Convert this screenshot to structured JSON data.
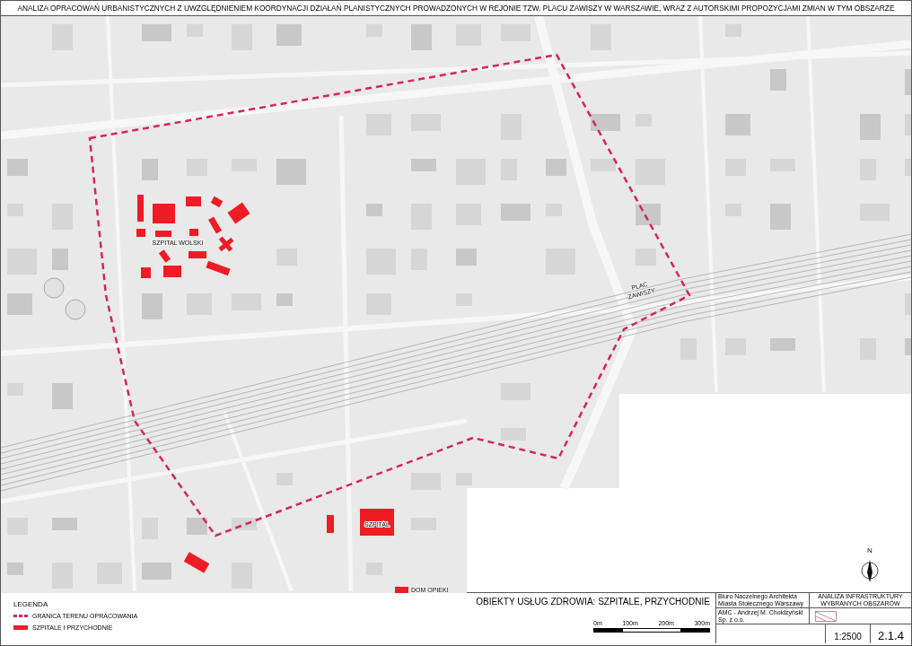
{
  "title": "ANALIZA OPRACOWAŃ URBANISTYCZNYCH Z UWZGLĘDNIENIEM KOORDYNACJI DZIAŁAŃ PLANISTYCZNYCH PROWADZONYCH W REJONIE TZW. PLACU ZAWISZY W WARSZAWIE, WRAZ Z AUTORSKIMI PROPOZYCJAMI ZMIAN W TYM OBSZARZE",
  "map": {
    "place_labels": [
      {
        "lines": [
          "SZPITAL WOLSKI"
        ]
      },
      {
        "lines": [
          "PLAC",
          "ZAWISZY"
        ]
      },
      {
        "lines": [
          "SZPITAL"
        ]
      },
      {
        "lines": [
          "DOM OPIEKI"
        ]
      }
    ],
    "north_label": "N"
  },
  "legend": {
    "title": "LEGENDA",
    "items": [
      {
        "kind": "boundary",
        "label": "GRANICA TERENU OPRACOWANIA"
      },
      {
        "kind": "area",
        "label": "SZPITALE I PRZYCHODNIE"
      }
    ]
  },
  "title_block": {
    "sheet_title": "OBIEKTY USŁUG ZDROWIA: SZPITALE, PRZYCHODNIE",
    "scale_bar_labels": [
      "0m",
      "100m",
      "200m",
      "300m"
    ],
    "client": [
      "Biuro Naczelnego Architekta",
      "Miasta Stołecznego Warszawy"
    ],
    "series": [
      "ANALIZA INFRASTRUKTURY",
      "WYBRANYCH OBSZARÓW"
    ],
    "author": "AMC - Andrzej M. Chołdzyński Sp. z o.o.",
    "scale": "1:2500",
    "sheet_number": "2.1.4"
  }
}
